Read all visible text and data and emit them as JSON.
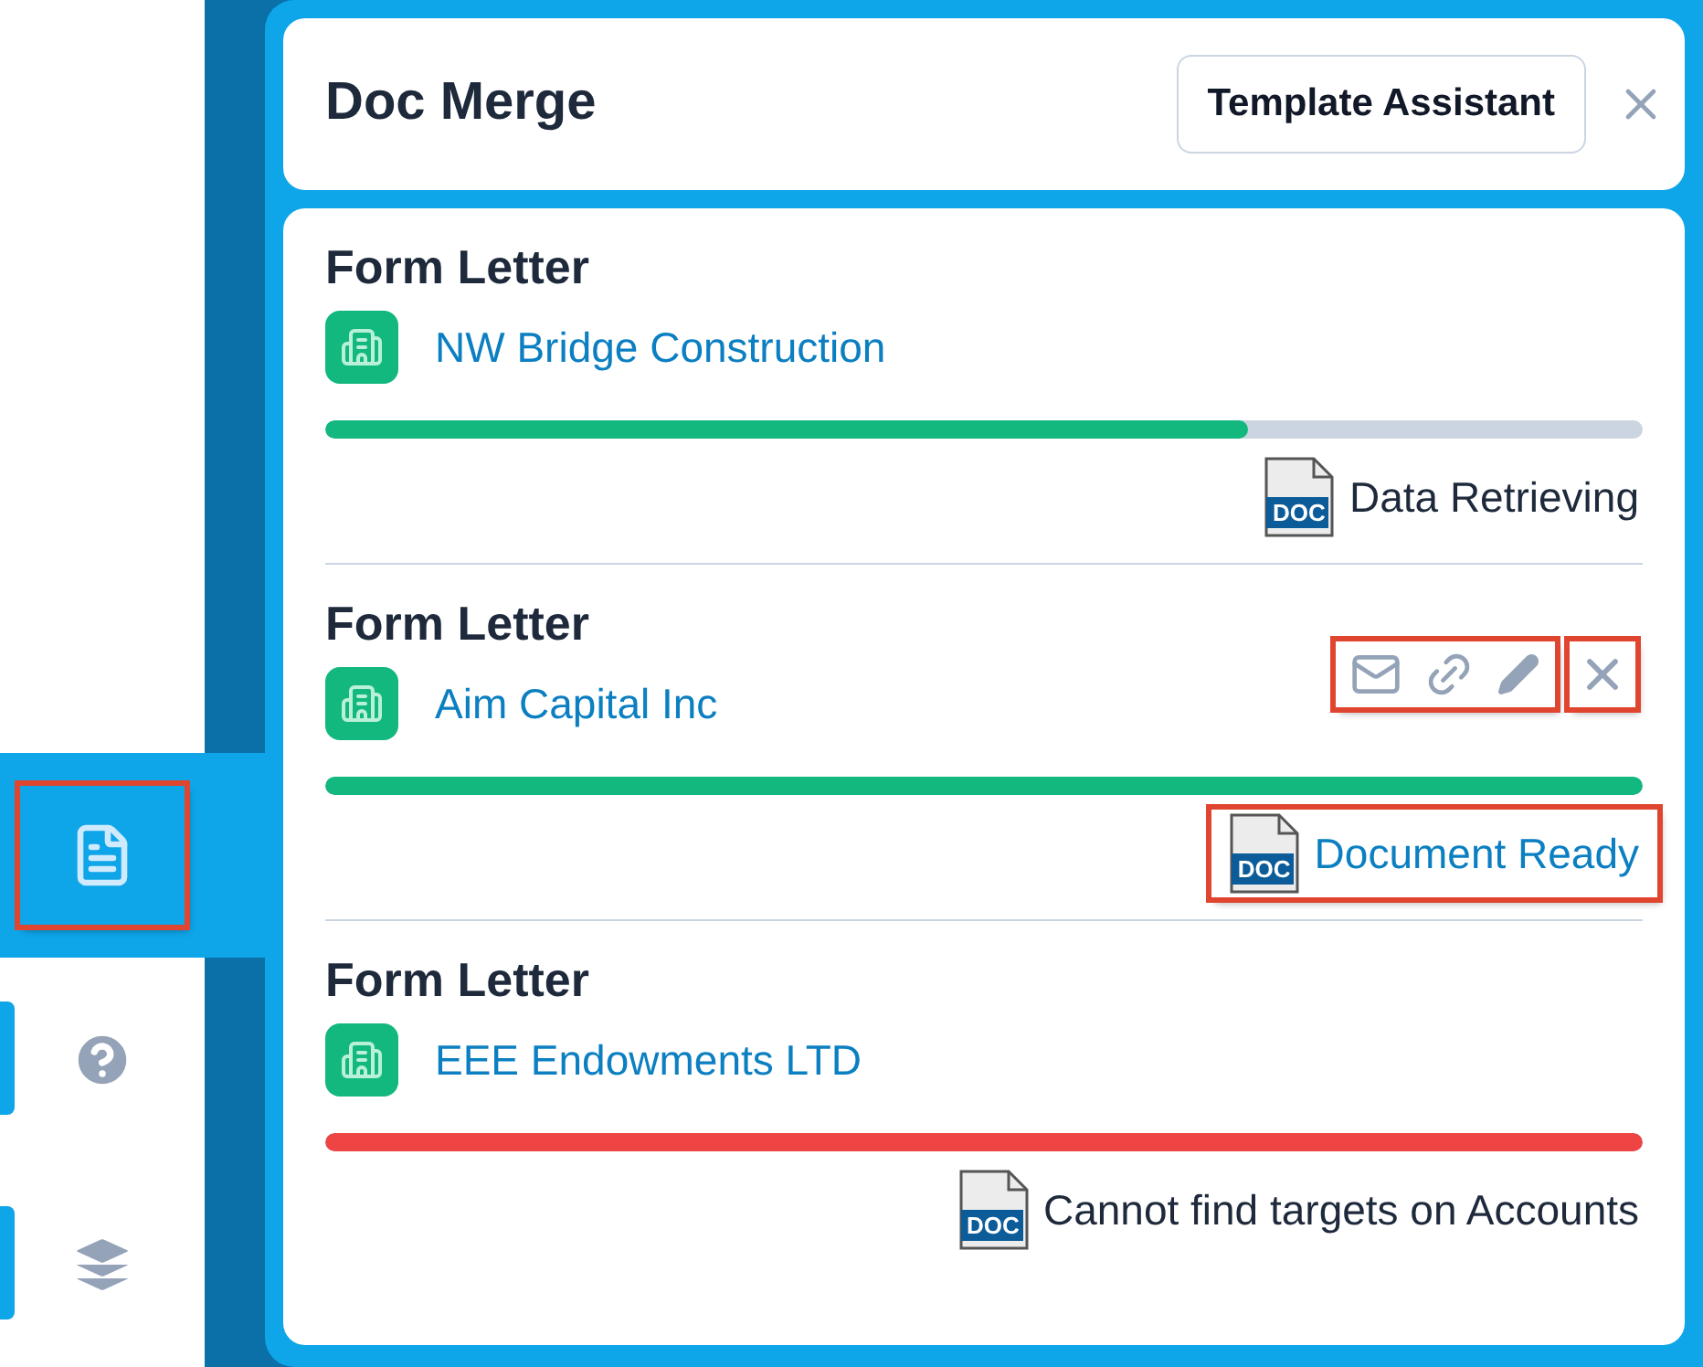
{
  "sidebar": {
    "items": [
      {
        "kind": "document",
        "selected": true,
        "highlighted": true
      },
      {
        "kind": "help",
        "selected": false,
        "highlighted": false
      },
      {
        "kind": "layers",
        "selected": false,
        "highlighted": false
      }
    ]
  },
  "panel": {
    "title": "Doc Merge",
    "template_button": "Template Assistant"
  },
  "merges": [
    {
      "title": "Form Letter",
      "account": "NW Bridge Construction",
      "level": 0.7,
      "kind": "retrieving",
      "file_badge": "DOC",
      "status": "Data Retrieving",
      "actions_shown": false,
      "highlighted": false
    },
    {
      "title": "Form Letter",
      "account": "Aim Capital Inc",
      "level": 1,
      "kind": "ready",
      "file_badge": "DOC",
      "status": "Document Ready",
      "actions_shown": true,
      "highlighted": true
    },
    {
      "title": "Form Letter",
      "account": "EEE Endowments LTD",
      "level": 1,
      "kind": "error",
      "file_badge": "DOC",
      "status": "Cannot find targets on Accounts",
      "actions_shown": false,
      "highlighted": false
    }
  ]
}
